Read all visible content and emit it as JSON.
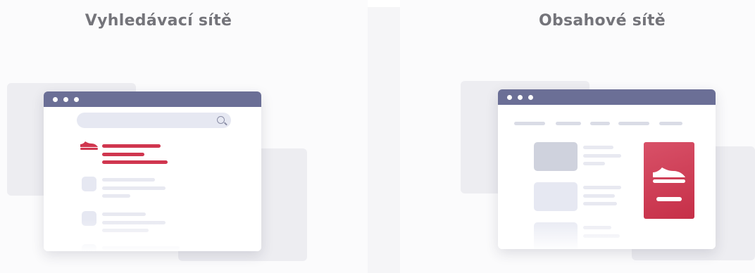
{
  "sections": {
    "search": {
      "title": "Vyhledávací sítě"
    },
    "display": {
      "title": "Obsahové sítě"
    }
  },
  "colors": {
    "browser_bar": "#6b6f96",
    "accent_red": "#d0364f",
    "placeholder": "#e6e8f2",
    "title_text": "#74747a"
  },
  "icons": [
    "search-icon",
    "sneaker-icon"
  ]
}
